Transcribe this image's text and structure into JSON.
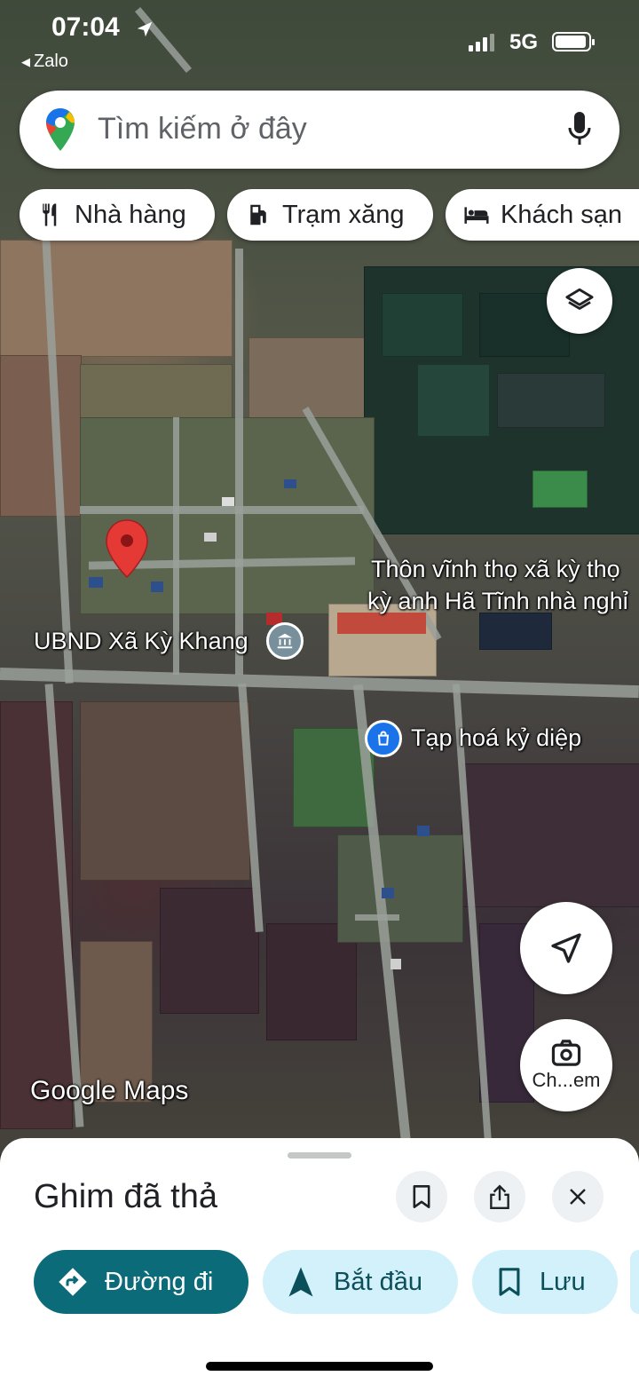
{
  "status_bar": {
    "time": "07:04",
    "back_app": "Zalo",
    "network": "5G"
  },
  "search": {
    "placeholder": "Tìm kiếm ở đây"
  },
  "chips": [
    {
      "label": "Nhà hàng",
      "icon": "restaurant-icon"
    },
    {
      "label": "Trạm xăng",
      "icon": "gas-station-icon"
    },
    {
      "label": "Khách sạn",
      "icon": "hotel-icon"
    }
  ],
  "map": {
    "labels": {
      "place_1_line1": "Thôn vĩnh thọ xã kỳ thọ",
      "place_1_line2": "kỳ anh Hã Tĩnh nhà nghỉ",
      "ubnd": "UBND Xã Kỳ Khang",
      "shop": "Tạp hoá kỷ diệp"
    },
    "watermark": "Google Maps",
    "camera_label": "Ch...em"
  },
  "sheet": {
    "title": "Ghim đã thả",
    "actions": [
      {
        "label": "Đường đi"
      },
      {
        "label": "Bắt đầu"
      },
      {
        "label": "Lưu"
      }
    ]
  },
  "colors": {
    "primary_action": "#0b6b78",
    "secondary_action": "#d3f1fa",
    "pin": "#e53935",
    "poi_blue": "#1a73e8"
  }
}
